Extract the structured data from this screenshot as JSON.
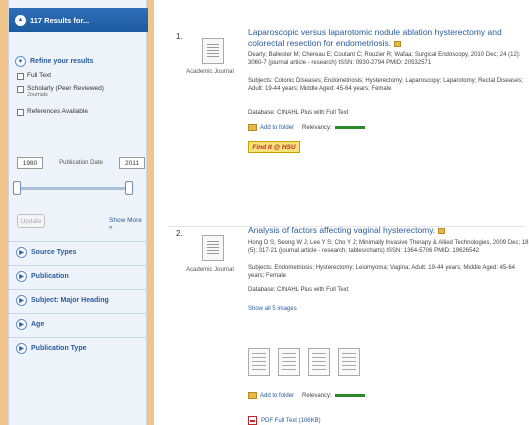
{
  "sidebar": {
    "results_header": "117 Results for...",
    "refine_title": "Refine your results",
    "full_text": "Full Text",
    "scholarly": "Scholarly (Peer Reviewed)",
    "scholarly_sub": "Journals",
    "references_available": "References Available",
    "date_from": "1980",
    "date_to": "2011",
    "publication_date_label": "Publication Date",
    "update_label": "Update",
    "show_more": "Show More »",
    "facets": [
      "Source Types",
      "Publication",
      "Subject: Major Heading",
      "Age",
      "Publication Type"
    ]
  },
  "results": [
    {
      "number": "1.",
      "source_type": "Academic Journal",
      "title": "Laparoscopic versus laparotomic nodule ablation hysterectomy and colorectal resection for endometriosis.",
      "authors": "Dearly; Ballester M; Chereau E; Coutant C; Rouzier R; Wafaa; Surgical Endoscopy, 2010 Dec; 24 (12): 3060-7 (journal article - research) ISSN: 0930-2794 PMID: 20532571",
      "subjects": "Subjects: Colonic Diseases; Endometriosis; Hysterectomy; Laparoscopy; Laparotomy; Rectal Diseases; Adult: 19-44 years; Middle Aged: 45-64 years; Female",
      "database": "Database: CINAHL Plus with Full Text",
      "add_to_folder": "Add to folder",
      "relevancy": "Relevancy:",
      "find_it": "Find It @ HSU"
    },
    {
      "number": "2.",
      "source_type": "Academic Journal",
      "title": "Analysis of factors affecting vaginal hysterectomy.",
      "authors": "Hong D S; Seong W J; Lee Y S; Cho Y J; Minimally Invasive Therapy & Allied Technologies, 2009 Dec; 18 (5): 317-21 (journal article - research, tables/charts) ISSN: 1364-5706 PMID: 19626542",
      "subjects": "Subjects: Endometriosis; Hysterectomy; Leiomyoma; Vagina; Adult: 19-44 years; Middle Aged: 45-64 years; Female",
      "database": "Database: CINAHL Plus with Full Text",
      "show_images": "Show all 5 images",
      "add_to_folder": "Add to folder",
      "relevancy": "Relevancy:",
      "pdf_label": "PDF Full Text (106KB)"
    }
  ]
}
